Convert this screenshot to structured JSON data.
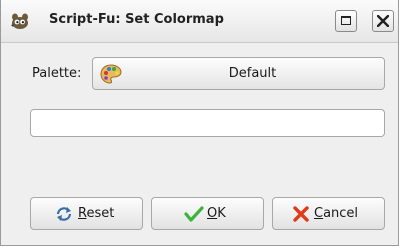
{
  "window": {
    "title": "Script-Fu: Set Colormap",
    "icon": "gimp-wilber-icon",
    "controls": {
      "maximize": "maximize-icon",
      "close": "close-icon"
    }
  },
  "form": {
    "palette_label": "Palette:",
    "palette_value": "Default",
    "palette_icon": "palette-icon",
    "text_value": ""
  },
  "buttons": {
    "reset": {
      "mnemonic": "R",
      "rest": "eset",
      "icon": "reset-icon"
    },
    "ok": {
      "mnemonic": "O",
      "rest": "K",
      "icon": "checkmark-icon"
    },
    "cancel": {
      "mnemonic": "C",
      "rest": "ancel",
      "icon": "cancel-x-icon"
    }
  },
  "colors": {
    "ok_check": "#3cb43c",
    "cancel_x": "#e03a1a",
    "reset_arrows": "#3a6ea5"
  }
}
